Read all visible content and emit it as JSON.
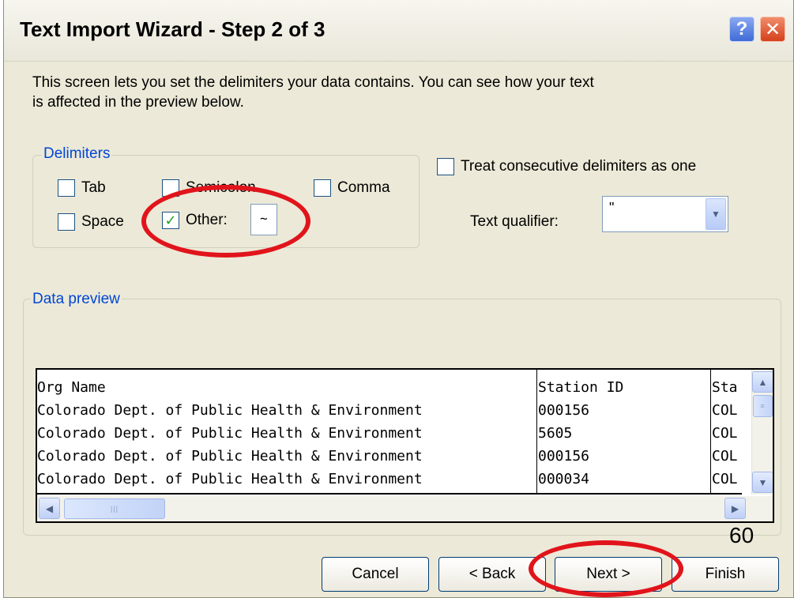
{
  "window": {
    "title": "Text Import Wizard - Step 2 of 3",
    "help_glyph": "?",
    "close_glyph": "✕"
  },
  "intro": "This screen lets you set the delimiters your data contains.  You can see how your text is affected in the preview below.",
  "delimiters": {
    "group_label": "Delimiters",
    "tab": {
      "label": "Tab",
      "checked": false
    },
    "semicolon": {
      "label": "Semicolon",
      "checked": false
    },
    "comma": {
      "label": "Comma",
      "checked": false
    },
    "space": {
      "label": "Space",
      "checked": false
    },
    "other": {
      "label": "Other:",
      "checked": true,
      "value": "~"
    }
  },
  "treat_consecutive": {
    "label": "Treat consecutive delimiters as one",
    "checked": false
  },
  "text_qualifier": {
    "label": "Text qualifier:",
    "value": "\""
  },
  "preview": {
    "group_label": "Data preview",
    "columns": [
      "Org Name",
      "Station ID",
      "Sta"
    ],
    "rows": [
      [
        "Colorado Dept. of Public Health & Environment",
        "000156",
        "COL"
      ],
      [
        "Colorado Dept. of Public Health & Environment",
        "5605",
        "COL"
      ],
      [
        "Colorado Dept. of Public Health & Environment",
        "000156",
        "COL"
      ],
      [
        "Colorado Dept. of Public Health & Environment",
        "000034",
        "COL"
      ]
    ]
  },
  "buttons": {
    "cancel": "Cancel",
    "back": "< Back",
    "next": "Next >",
    "finish": "Finish"
  },
  "page_number": "60",
  "colors": {
    "dialog_bg": "#ece9d8",
    "group_label": "#0046d5",
    "annotation": "#e1141b",
    "check": "#21a121"
  }
}
